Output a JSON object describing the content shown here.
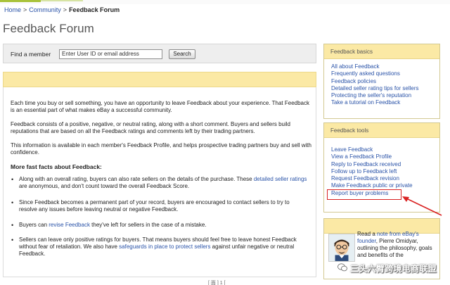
{
  "breadcrumb": {
    "home": "Home",
    "community": "Community",
    "current": "Feedback Forum",
    "separator": ">"
  },
  "page_title": "Feedback Forum",
  "search": {
    "label": "Find a member",
    "placeholder": "Enter User ID or email address",
    "button": "Search"
  },
  "main": {
    "intro_1": "Each time you buy or sell something, you have an opportunity to leave Feedback about your experience. That Feedback is an essential part of what makes eBay a successful community.",
    "intro_2": "Feedback consists of a positive, negative, or neutral rating, along with a short comment. Buyers and sellers build reputations that are based on all the Feedback ratings and comments left by their trading partners.",
    "intro_3": "This information is available in each member's Feedback Profile, and helps prospective trading partners buy and sell with confidence.",
    "facts_heading": "More fast facts about Feedback:",
    "fact_1_a": "Along with an overall rating, buyers can also rate sellers on the details of the purchase. These ",
    "fact_1_link": "detailed seller ratings",
    "fact_1_b": " are anonymous, and don't count toward the overall Feedback Score.",
    "fact_2": "Since Feedback becomes a permanent part of your record, buyers are encouraged to contact sellers to try to resolve any issues before leaving neutral or negative Feedback.",
    "fact_3_a": "Buyers can ",
    "fact_3_link": "revise Feedback",
    "fact_3_b": " they've left for sellers in the case of a mistake.",
    "fact_4_a": "Sellers can leave only positive ratings for buyers. That means buyers should feel free to leave honest Feedback without fear of retaliation. We also have ",
    "fact_4_link": "safeguards in place to protect sellers",
    "fact_4_b": " against unfair negative or neutral Feedback."
  },
  "footer_text": "[ 面 ] 1 [",
  "sidebar": {
    "basics": {
      "title": "Feedback basics",
      "items": [
        "All about Feedback",
        "Frequently asked questions",
        "Feedback policies",
        "Detailed seller rating tips for sellers",
        "Protecting the seller's reputation",
        "Take a tutorial on Feedback"
      ]
    },
    "tools": {
      "title": "Feedback tools",
      "items": [
        "Leave Feedback",
        "View a Feedback Profile",
        "Reply to Feedback received",
        "Follow up to Feedback left",
        "Request Feedback revision",
        "Make Feedback public or private",
        "Report buyer problems"
      ]
    },
    "note": {
      "text_a": "Read a ",
      "link": "note from eBay's founder",
      "text_b": ", Pierre Omidyar, outlining the philosophy, goals and benefits of the"
    }
  },
  "watermark": "三头六臂跨境电商联盟",
  "colors": {
    "link": "#2a53a8",
    "panel_header": "#fbe9a5",
    "highlight": "#d92222",
    "accent_green": "#a9c23a"
  }
}
